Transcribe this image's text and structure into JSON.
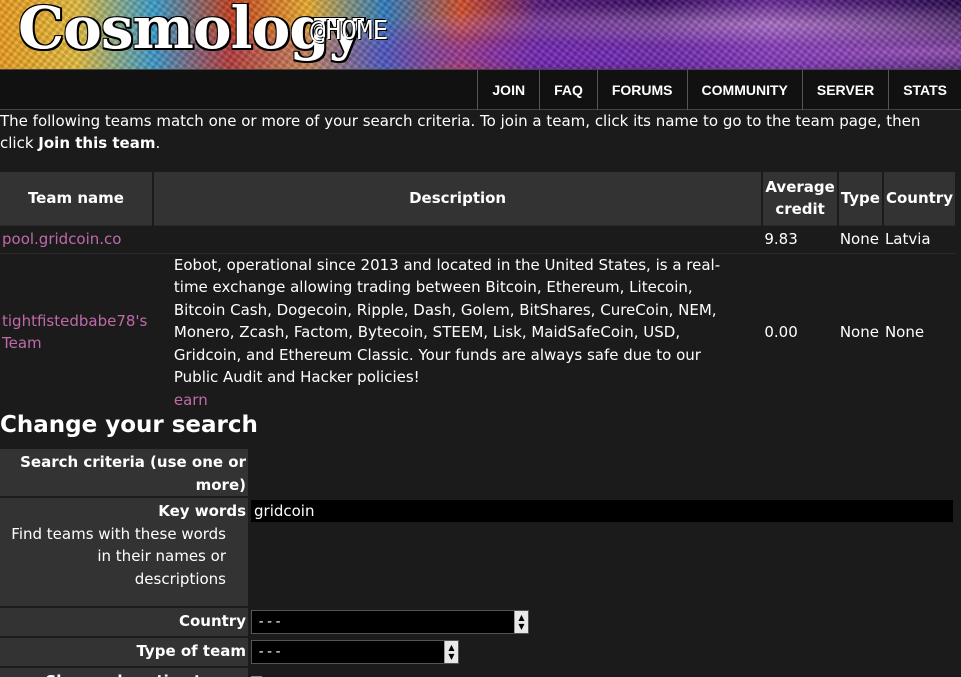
{
  "banner": {
    "logo": "Cosmology",
    "logo_sub": "@HOME"
  },
  "nav": {
    "items": [
      "JOIN",
      "FAQ",
      "FORUMS",
      "COMMUNITY",
      "SERVER",
      "STATS"
    ]
  },
  "intro": {
    "text": "The following teams match one or more of your search criteria. To join a team, click its name to go to the team page, then click ",
    "bold": "Join this team",
    "end": "."
  },
  "teams_table": {
    "headers": [
      "Team name",
      "Description",
      "Average credit",
      "Type",
      "Country"
    ],
    "rows": [
      {
        "name": "pool.gridcoin.co",
        "description": "",
        "link": "",
        "credit": "9.83",
        "type": "None",
        "country": "Latvia"
      },
      {
        "name": "tightfistedbabe78's Team",
        "description": "Eobot, operational since 2013 and located in the United States, is a real-time exchange allowing trading between Bitcoin, Ethereum, Litecoin, Bitcoin Cash, Dogecoin, Ripple, Dash, Golem, BitShares, CureCoin, NEM, Monero, Zcash, Factom, Bytecoin, STEEM, Lisk, MaidSafeCoin, USD, Gridcoin, and Ethereum Classic. Your funds are always safe due to our Public Audit and Hacker policies!",
        "link": "earn",
        "credit": "0.00",
        "type": "None",
        "country": "None"
      }
    ]
  },
  "search": {
    "heading": "Change your search",
    "criteria_label": "Search criteria (use one or more)",
    "keywords_label": "Key words",
    "keywords_hint": "Find teams with these words in their names or descriptions",
    "keywords_value": "gridcoin",
    "country_label": "Country",
    "country_value": "---",
    "type_label": "Type of team",
    "type_value": "---",
    "active_label": "Show only active teams"
  }
}
